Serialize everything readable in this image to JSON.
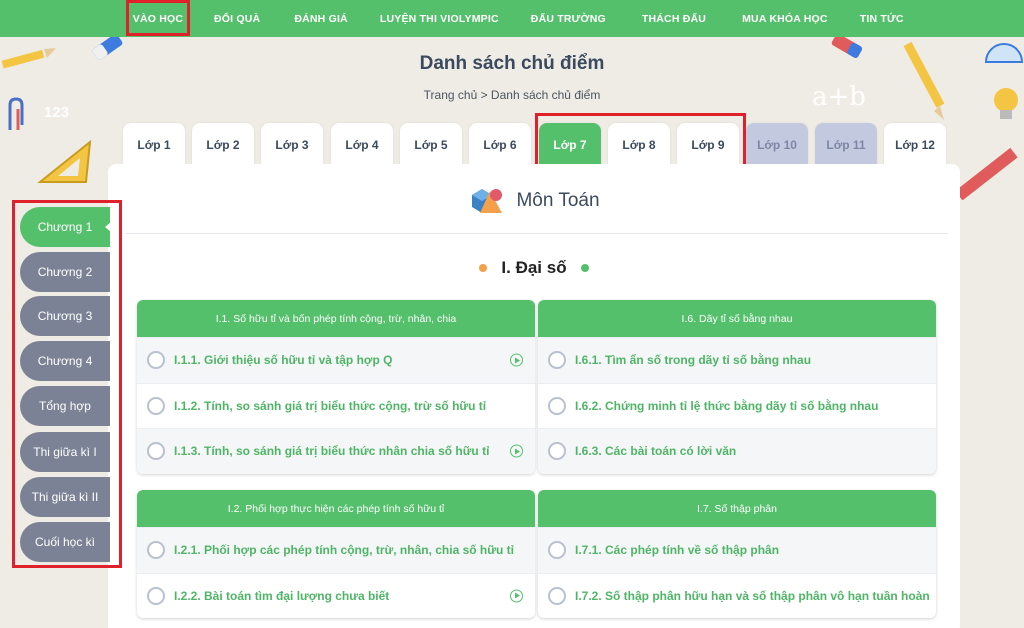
{
  "nav": {
    "items": [
      "VÀO HỌC",
      "ĐỔI QUÀ",
      "ĐÁNH GIÁ",
      "LUYỆN THI VIOLYMPIC",
      "ĐẤU TRƯỜNG",
      "THÁCH ĐẤU",
      "MUA KHÓA HỌC",
      "TIN TỨC"
    ]
  },
  "page": {
    "title": "Danh sách chủ điểm",
    "breadcrumb": "Trang chủ > Danh sách chủ điểm"
  },
  "grades": [
    {
      "label": "Lớp 1",
      "state": "normal"
    },
    {
      "label": "Lớp 2",
      "state": "normal"
    },
    {
      "label": "Lớp 3",
      "state": "normal"
    },
    {
      "label": "Lớp 4",
      "state": "normal"
    },
    {
      "label": "Lớp 5",
      "state": "normal"
    },
    {
      "label": "Lớp 6",
      "state": "normal"
    },
    {
      "label": "Lớp 7",
      "state": "active"
    },
    {
      "label": "Lớp 8",
      "state": "normal"
    },
    {
      "label": "Lớp 9",
      "state": "normal"
    },
    {
      "label": "Lớp 10",
      "state": "disabled"
    },
    {
      "label": "Lớp 11",
      "state": "disabled"
    },
    {
      "label": "Lớp 12",
      "state": "normal"
    }
  ],
  "subject": {
    "title": "Môn Toán",
    "icon": "shapes-icon"
  },
  "section": {
    "title": "I. Đại số"
  },
  "chapters": [
    {
      "label": "Chương 1",
      "active": true
    },
    {
      "label": "Chương 2",
      "active": false
    },
    {
      "label": "Chương 3",
      "active": false
    },
    {
      "label": "Chương 4",
      "active": false
    },
    {
      "label": "Tổng hợp",
      "active": false
    },
    {
      "label": "Thi giữa kì I",
      "active": false
    },
    {
      "label": "Thi giữa kì II",
      "active": false
    },
    {
      "label": "Cuối học kì",
      "active": false
    }
  ],
  "panels": [
    {
      "title": "I.1. Số hữu tỉ và bốn phép tính cộng, trừ, nhân, chia",
      "lessons": [
        {
          "label": "I.1.1. Giới thiệu số hữu tỉ và tập hợp Q",
          "video": true
        },
        {
          "label": "I.1.2. Tính, so sánh giá trị biểu thức cộng, trừ số hữu tỉ",
          "video": false
        },
        {
          "label": "I.1.3. Tính, so sánh giá trị biểu thức nhân chia số hữu tỉ",
          "video": true
        }
      ]
    },
    {
      "title": "I.6. Dãy tỉ số bằng nhau",
      "lessons": [
        {
          "label": "I.6.1. Tìm ẩn số trong dãy tỉ số bằng nhau",
          "video": false
        },
        {
          "label": "I.6.2. Chứng minh tỉ lệ thức bằng dãy tỉ số bằng nhau",
          "video": false
        },
        {
          "label": "I.6.3. Các bài toán có lời văn",
          "video": false
        }
      ]
    },
    {
      "title": "I.2. Phối hợp thực hiện các phép tính số hữu tỉ",
      "lessons": [
        {
          "label": "I.2.1. Phối hợp các phép tính cộng, trừ, nhân, chia số hữu tỉ",
          "video": false
        },
        {
          "label": "I.2.2. Bài toán tìm đại lượng chưa biết",
          "video": true
        }
      ]
    },
    {
      "title": "I.7. Số thập phân",
      "lessons": [
        {
          "label": "I.7.1. Các phép tính về số thập phân",
          "video": false
        },
        {
          "label": "I.7.2. Số thập phân hữu hạn và số thập phân vô hạn tuần hoàn",
          "video": false
        }
      ]
    }
  ],
  "colors": {
    "accent": "#55c06c",
    "chapter_inactive": "#7b8296",
    "highlight": "#e0202a",
    "grade_disabled": "#c3c9de"
  }
}
